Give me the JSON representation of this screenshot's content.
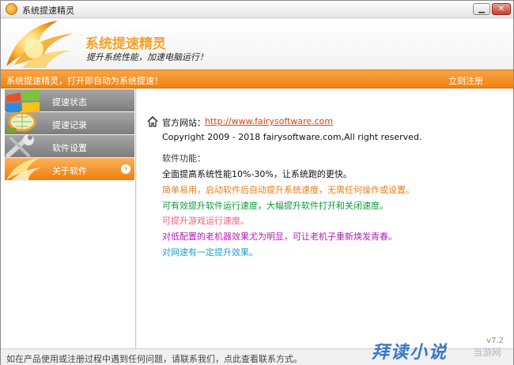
{
  "window": {
    "title": "系统提速精灵",
    "min_glyph": "▁",
    "close_glyph": "✕"
  },
  "header": {
    "app_name": "系统提速精灵",
    "slogan": "提升系统性能，加速电脑运行！"
  },
  "banner": {
    "text": "系统提速精灵，打开即自动为系统提速！",
    "register_link": "立刻注册"
  },
  "sidebar": {
    "items": [
      {
        "label": "提速状态",
        "icon": "windows-logo-icon",
        "active": false
      },
      {
        "label": "提速记录",
        "icon": "racket-icon",
        "active": false
      },
      {
        "label": "软件设置",
        "icon": "wrench-icon",
        "active": false
      },
      {
        "label": "关于软件",
        "icon": "rocket-icon",
        "active": true,
        "chevron": "›"
      }
    ]
  },
  "about": {
    "site_label": "官方网站：",
    "site_url": "http://www.fairysoftware.com",
    "copyright": "Copyright 2009 - 2018 fairysoftware.com,All right reserved.",
    "features_title": "软件功能：",
    "features": [
      "全面提高系统性能10%-30%，让系统跑的更快。",
      "简单易用，启动软件后自动提升系统速度，无需任何操作或设置。",
      "可有效提升软件运行速度，大幅提升软件打开和关闭速度。",
      "可提升游戏运行速度。",
      "对低配置的老机器效果尤为明显，可让老机子重新焕发青春。",
      "对网速有一定提升效果。"
    ],
    "version": "v7.2"
  },
  "status": {
    "text": "如在产品使用或注册过程中遇到任何问题，请联系我们，点此查看联系方式。"
  },
  "watermark": {
    "text": "拜读小说",
    "sub": "当游网"
  },
  "colors": {
    "accent": "#f08310",
    "link": "#d9431b",
    "nav_gray": "#8e8e8e"
  }
}
